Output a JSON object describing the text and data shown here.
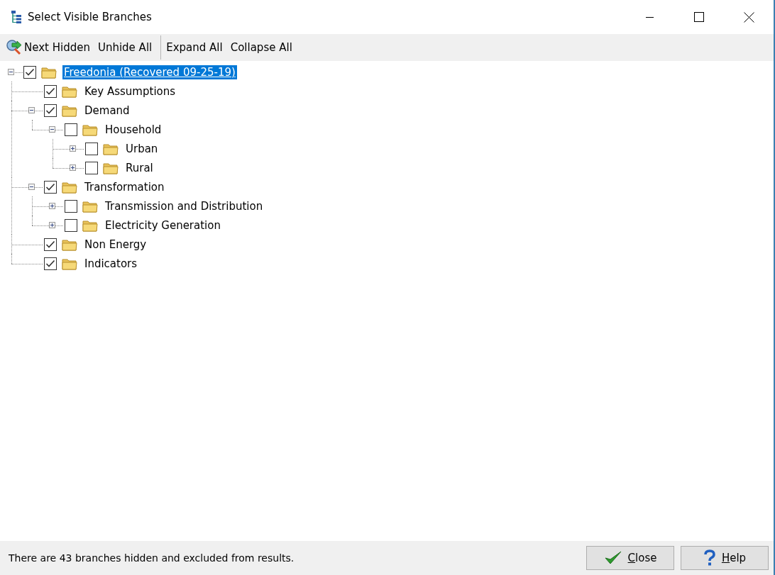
{
  "window": {
    "title": "Select Visible Branches"
  },
  "toolbar": [
    {
      "label": "Next Hidden",
      "icon": true
    },
    {
      "label": "Unhide All",
      "icon": false
    },
    {
      "label": "Expand All",
      "icon": false
    },
    {
      "label": "Collapse All",
      "icon": false
    }
  ],
  "tree": [
    {
      "label": "Freedonia (Recovered 09-25-19)",
      "checked": true,
      "selected": true,
      "expanded": true,
      "children": [
        {
          "label": "Key Assumptions",
          "checked": true,
          "selected": false
        },
        {
          "label": "Demand",
          "checked": true,
          "selected": false,
          "expanded": true,
          "children": [
            {
              "label": "Household",
              "checked": false,
              "selected": false,
              "expanded": true,
              "children": [
                {
                  "label": "Urban",
                  "checked": false,
                  "selected": false,
                  "expanded": false
                },
                {
                  "label": "Rural",
                  "checked": false,
                  "selected": false,
                  "expanded": false
                }
              ]
            }
          ]
        },
        {
          "label": "Transformation",
          "checked": true,
          "selected": false,
          "expanded": true,
          "children": [
            {
              "label": "Transmission and Distribution",
              "checked": false,
              "selected": false,
              "expanded": false
            },
            {
              "label": "Electricity Generation",
              "checked": false,
              "selected": false,
              "expanded": false
            }
          ]
        },
        {
          "label": "Non Energy",
          "checked": true,
          "selected": false
        },
        {
          "label": "Indicators",
          "checked": true,
          "selected": false
        }
      ]
    }
  ],
  "status_bar": {
    "text": "There are 43 branches hidden and excluded from results."
  },
  "buttons": [
    {
      "label": "Close",
      "kind": "close"
    },
    {
      "label": "Help",
      "kind": "help"
    }
  ]
}
